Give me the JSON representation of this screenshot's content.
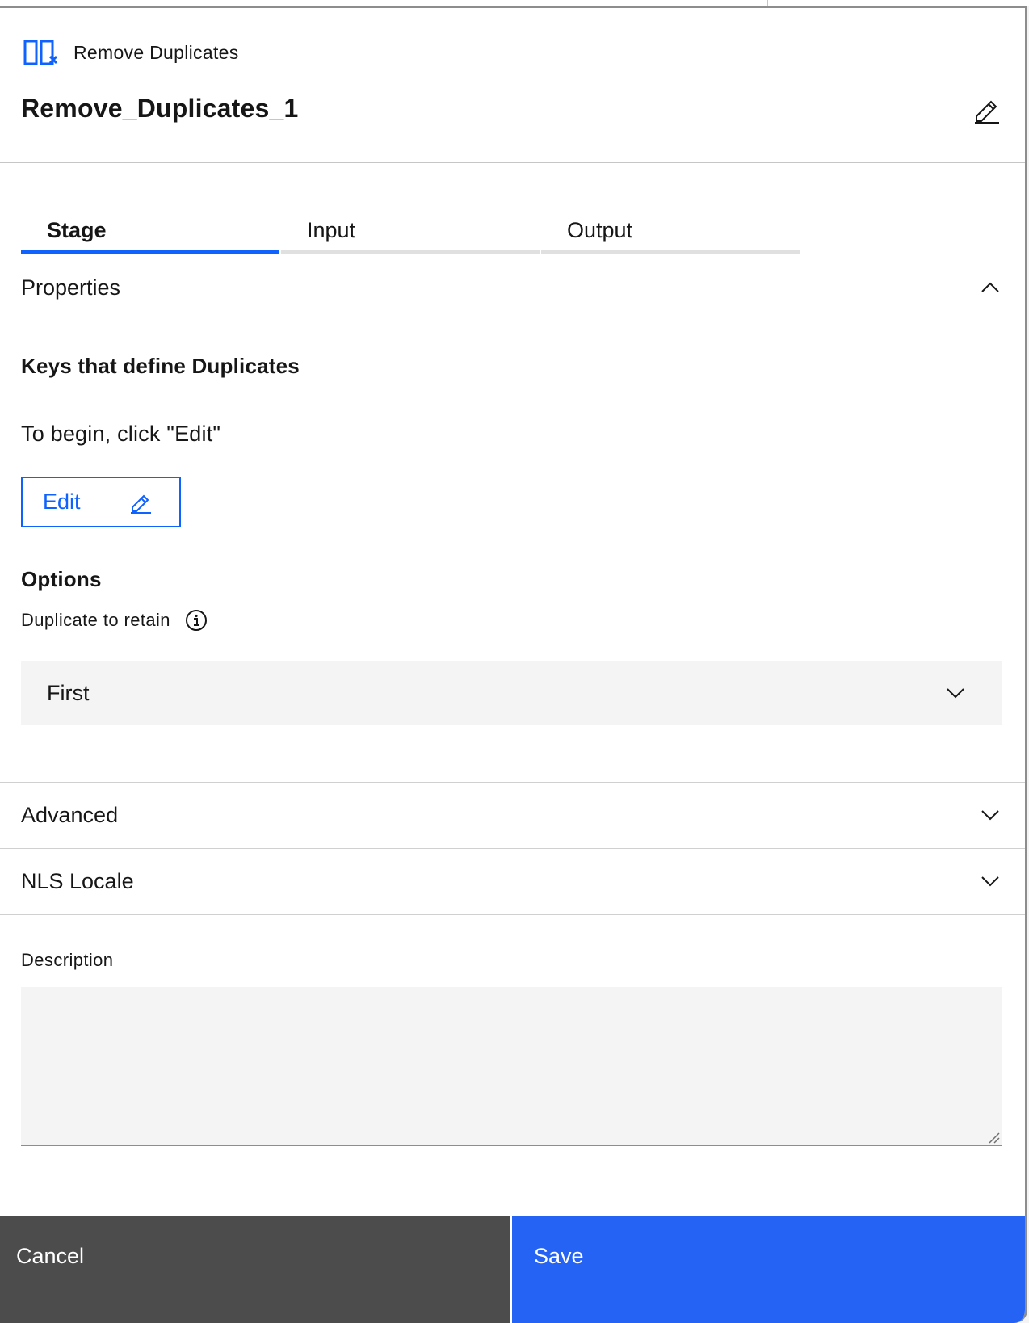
{
  "header": {
    "stage_type": "Remove Duplicates",
    "stage_name": "Remove_Duplicates_1",
    "stage_icon": "remove-duplicates-icon",
    "rename_icon": "edit-pencil-icon"
  },
  "tabs": [
    {
      "label": "Stage",
      "active": true
    },
    {
      "label": "Input",
      "active": false
    },
    {
      "label": "Output",
      "active": false
    }
  ],
  "properties": {
    "section_label": "Properties",
    "expanded": true,
    "keys": {
      "heading": "Keys that define Duplicates",
      "hint": "To begin, click \"Edit\"",
      "edit_label": "Edit"
    },
    "options": {
      "heading": "Options",
      "duplicate_to_retain_label": "Duplicate to retain",
      "duplicate_to_retain_value": "First"
    }
  },
  "sections": {
    "advanced": "Advanced",
    "nls_locale": "NLS Locale"
  },
  "description": {
    "label": "Description",
    "value": ""
  },
  "footer": {
    "cancel": "Cancel",
    "save": "Save"
  },
  "colors": {
    "accent": "#0f62fe",
    "save_bg": "#2563f5",
    "cancel_bg": "#4c4c4c",
    "field_bg": "#f4f4f4"
  }
}
